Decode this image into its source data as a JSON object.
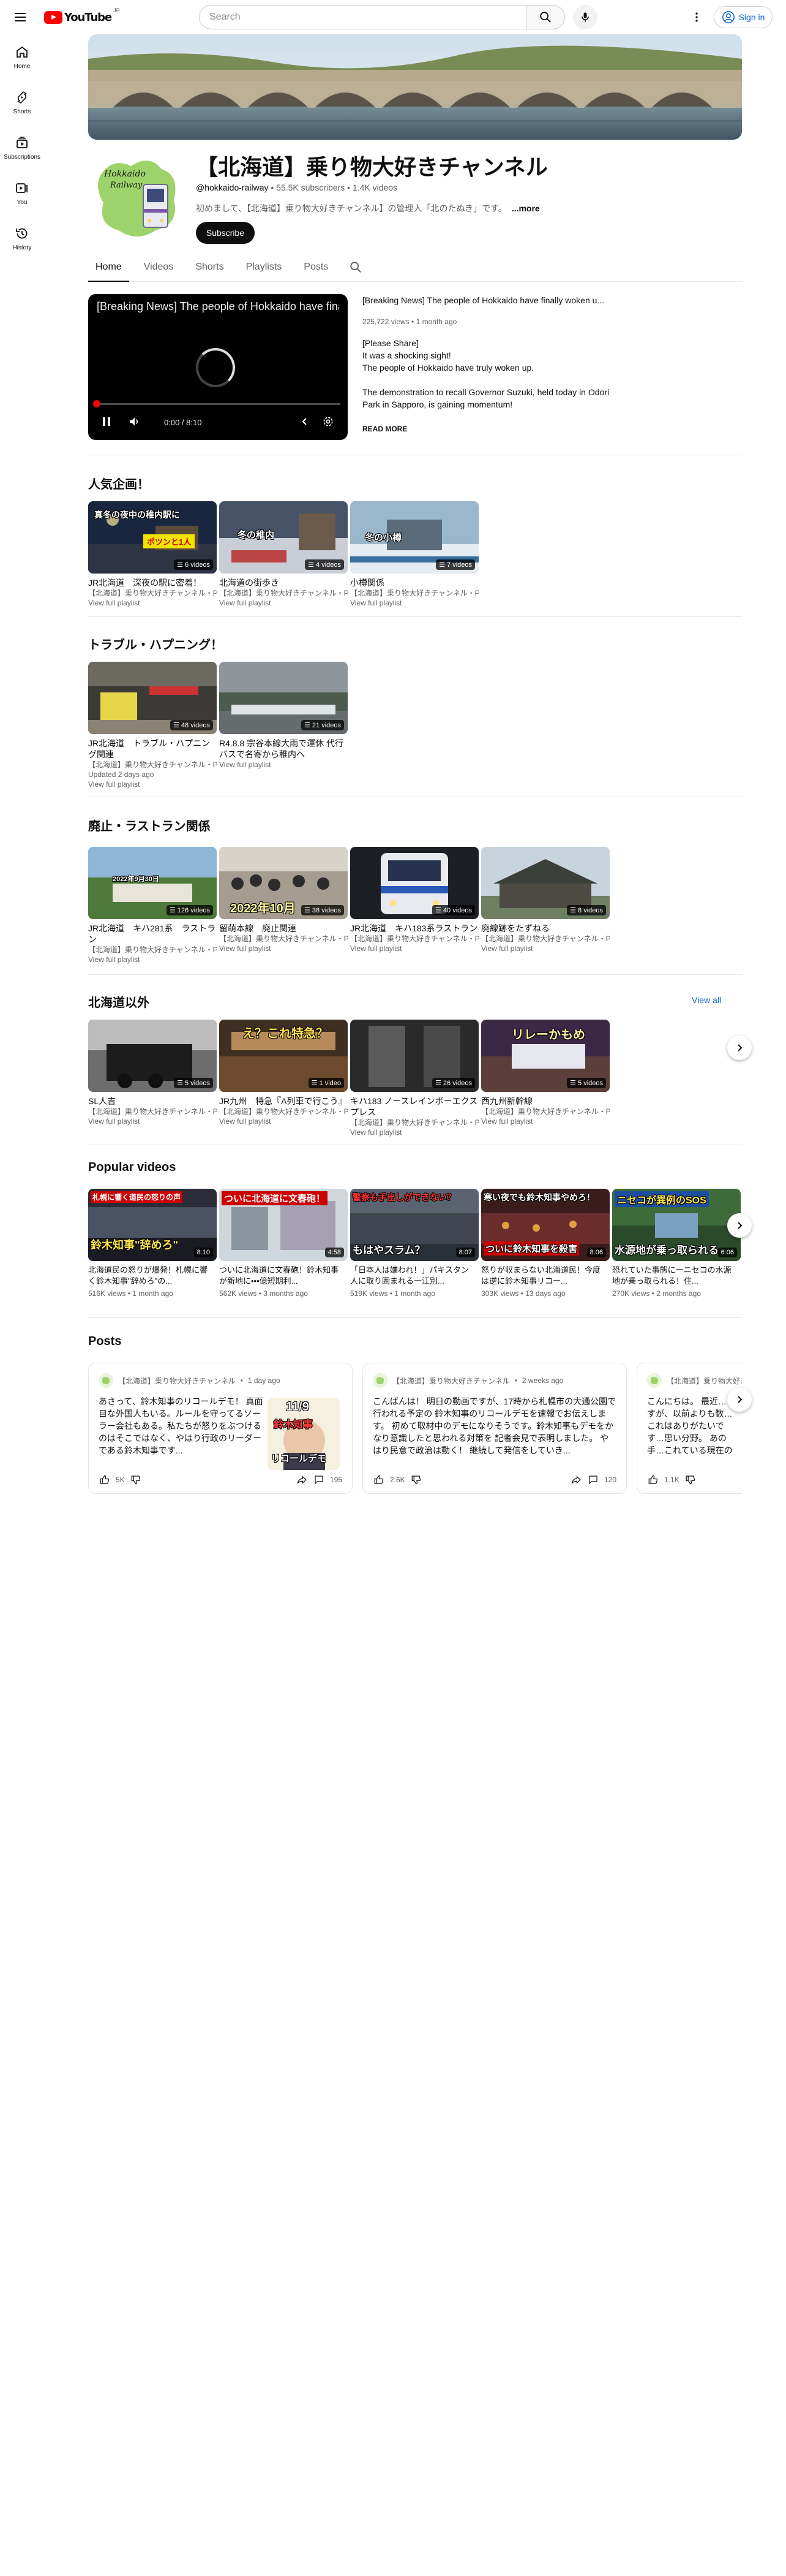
{
  "header": {
    "logo_text": "YouTube",
    "logo_cc": "JP",
    "search_placeholder": "Search",
    "signin_label": "Sign in"
  },
  "guide": [
    {
      "label": "Home",
      "icon": "home-icon"
    },
    {
      "label": "Shorts",
      "icon": "shorts-icon"
    },
    {
      "label": "Subscriptions",
      "icon": "subscriptions-icon"
    },
    {
      "label": "You",
      "icon": "you-icon"
    },
    {
      "label": "History",
      "icon": "history-icon"
    }
  ],
  "channel": {
    "title": "【北海道】乗り物大好きチャンネル",
    "handle": "@hokkaido-railway",
    "subscribers": "55.5K subscribers",
    "videos": "1.4K videos",
    "description": "初めまして、【北海道】乗り物大好きチャンネル】の管理人「北のたぬき」です。",
    "more_label": "...more",
    "subscribe_label": "Subscribe",
    "avatar_text_1": "Hokkaido",
    "avatar_text_2": "Railway"
  },
  "tabs": [
    "Home",
    "Videos",
    "Shorts",
    "Playlists",
    "Posts"
  ],
  "featured": {
    "player_title": "[Breaking News] The people of Hokkaido have finally woken up.",
    "time": "0:00 / 8:10",
    "progress": 0,
    "title": "[Breaking News] The people of Hokkaido have finally woken u...",
    "meta": "225,722 views • 1 month ago",
    "desc": [
      "[Please Share]",
      "It was a shocking sight!",
      "The people of Hokkaido have truly woken up.",
      "",
      "The demonstration to recall Governor Suzuki, held today in Odori Park in Sapporo, is gaining momentum!"
    ],
    "read_more": "READ MORE"
  },
  "sections": {
    "popular_plans": "人気企画！",
    "trouble": "トラブル・ハプニング！",
    "abolition": "廃止・ラストラン関係",
    "outside": "北海道以外",
    "view_all": "View all",
    "popular_videos": "Popular videos",
    "posts": "Posts"
  },
  "playlists_1": [
    {
      "title": "JR北海道　深夜の駅に密着！",
      "meta": "【北海道】乗り物大好きチャンネル・P",
      "count": "6 videos",
      "view": "View full playlist",
      "overlay": "真冬の夜中の稚内駅に"
    },
    {
      "title": "北海道の街歩き",
      "meta": "【北海道】乗り物大好きチャンネル・P",
      "count": "4 videos",
      "view": "View full playlist",
      "overlay": "冬の稚内"
    },
    {
      "title": "小樽関係",
      "meta": "【北海道】乗り物大好きチャンネル・P",
      "count": "7 videos",
      "view": "View full playlist",
      "overlay": "冬の小樽"
    }
  ],
  "playlists_2": [
    {
      "title": "JR北海道　トラブル・ハプニング関連",
      "meta": "【北海道】乗り物大好きチャンネル・P",
      "count": "48 videos",
      "updated": "Updated 2 days ago",
      "view": "View full playlist"
    },
    {
      "title": "R4.8.8 宗谷本線大雨で運休 代行バスで名寄から稚内へ",
      "meta": "",
      "count": "21 videos",
      "updated": "",
      "view": "View full playlist"
    }
  ],
  "playlists_3": [
    {
      "title": "JR北海道　キハ281系　ラストラン",
      "meta": "【北海道】乗り物大好きチャンネル・P",
      "count": "126 videos",
      "view": "View full playlist",
      "overlay": "2022年9月30日"
    },
    {
      "title": "留萌本線　廃止関連",
      "meta": "【北海道】乗り物大好きチャンネル・P",
      "count": "38 videos",
      "view": "View full playlist",
      "overlay": "2022年10月"
    },
    {
      "title": "JR北海道　キハ183系ラストラン",
      "meta": "【北海道】乗り物大好きチャンネル・P",
      "count": "40 videos",
      "view": "View full playlist",
      "overlay": ""
    },
    {
      "title": "廃線跡をたずねる",
      "meta": "【北海道】乗り物大好きチャンネル・P",
      "count": "8 videos",
      "view": "View full playlist",
      "overlay": ""
    }
  ],
  "playlists_4": [
    {
      "title": "SL人吉",
      "meta": "【北海道】乗り物大好きチャンネル・P",
      "count": "5 videos",
      "view": "View full playlist",
      "overlay": ""
    },
    {
      "title": "JR九州　特急『A列車で行こう』",
      "meta": "【北海道】乗り物大好きチャンネル・P",
      "count": "1 video",
      "view": "View full playlist",
      "overlay": "え？これ特急？"
    },
    {
      "title": "キハ183 ノースレインボーエクスプレス",
      "meta": "【北海道】乗り物大好きチャンネル・P",
      "count": "26 videos",
      "view": "View full playlist",
      "overlay": ""
    },
    {
      "title": "西九州新幹線",
      "meta": "【北海道】乗り物大好きチャンネル・P",
      "count": "5 videos",
      "view": "View full playlist",
      "overlay": "リレーかもめ"
    }
  ],
  "popular": [
    {
      "title": "北海道民の怒りが爆発！札幌に響く鈴木知事\"辞めろ\"の...",
      "meta": "516K views • 1 month ago",
      "duration": "8:10",
      "overlay": "札幌に響く道民の怒りの声",
      "overlay2": "鈴木知事\"辞めろ\""
    },
    {
      "title": "ついに北海道に文春砲！鈴木知事が新地に•••億短期利...",
      "meta": "562K views • 3 months ago",
      "duration": "4:58",
      "overlay": "ついに北海道に文春砲！",
      "overlay2": ""
    },
    {
      "title": "「日本人は嫌われ！」パキスタン人に取り囲まれる一江別...",
      "meta": "519K views • 1 month ago",
      "duration": "8:07",
      "overlay": "警察も手出しができない？",
      "overlay2": "もはやスラム？"
    },
    {
      "title": "怒りが収まらない北海道民！今度は逆に鈴木知事リコー...",
      "meta": "303K views • 13 days ago",
      "duration": "8:06",
      "overlay": "寒い夜でも鈴木知事やめろ！",
      "overlay2": "ついに鈴木知事を殺害"
    },
    {
      "title": "恐れていた事態にーニセコの水源地が乗っ取られる！住...",
      "meta": "270K views • 2 months ago",
      "duration": "6:06",
      "overlay": "ニセコが異例のSOS",
      "overlay2": "水源地が乗っ取られる"
    }
  ],
  "posts": [
    {
      "author": "【北海道】乗り物大好きチャンネル",
      "time": "1 day ago",
      "body": "あさって、鈴木知事のリコールデモ！ 真面目な外国人もいる。ルールを守ってるソーラー会社もある。私たちが怒りをぶつけるのはそこではなく、やはり行政のリーダーである鈴木知事です...",
      "likes": "5K",
      "comments": "195",
      "img_text": "11/9",
      "img_text2": "鈴木知事",
      "img_text3": "リコールデモ"
    },
    {
      "author": "【北海道】乗り物大好きチャンネル",
      "time": "2 weeks ago",
      "body": "こんばんは！ 明日の動画ですが、17時から札幌市の大通公園で行われる予定の 鈴木知事のリコールデモを速報でお伝えします。 初めて取材中のデモになりそうです。鈴木知事もデモをかなり意識したと思われる対策を 記者会見で表明しました。 やはり民意で政治は動く！ 継続して発信をしていき...",
      "likes": "2.6K",
      "comments": "120"
    },
    {
      "author": "【北海道】乗り物大好きチャンネル",
      "time": "",
      "body": "こんにちは。 最近…ですが、以前よりも数…これはありがたいです…思い分野。 あの手…これている現在の厳しい…",
      "likes": "1.1K",
      "comments": ""
    }
  ],
  "colors": {
    "accent": "#065fd4",
    "brand": "#ff0000"
  }
}
